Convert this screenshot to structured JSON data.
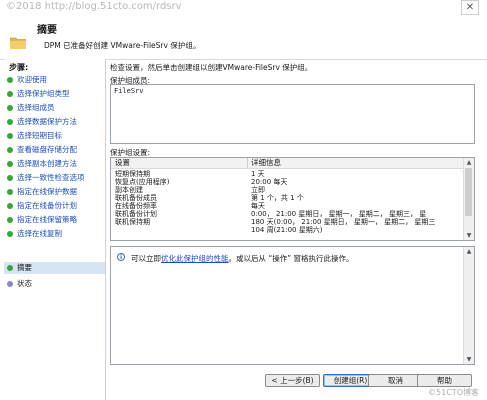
{
  "watermark_top": "©2018 http://blog.51cto.com/rdsrv",
  "header": {
    "title": "摘要",
    "description": "DPM 已准备好创建 VMware-FileSrv 保护组。"
  },
  "steps": {
    "title": "步骤:",
    "items": [
      {
        "label": "欢迎使用",
        "state": "done"
      },
      {
        "label": "选择保护组类型",
        "state": "done"
      },
      {
        "label": "选择组成员",
        "state": "done"
      },
      {
        "label": "选择数据保护方法",
        "state": "done"
      },
      {
        "label": "选择短期目标",
        "state": "done"
      },
      {
        "label": "查看磁盘存储分配",
        "state": "done"
      },
      {
        "label": "选择副本创建方法",
        "state": "done"
      },
      {
        "label": "选择一致性检查选项",
        "state": "done"
      },
      {
        "label": "指定在线保护数据",
        "state": "done"
      },
      {
        "label": "指定在线备份计划",
        "state": "done"
      },
      {
        "label": "指定在线保留策略",
        "state": "done"
      },
      {
        "label": "选择在线复制",
        "state": "done"
      },
      {
        "label": "摘要",
        "state": "current"
      },
      {
        "label": "状态",
        "state": "pending"
      }
    ]
  },
  "main": {
    "instruction": "检查设置，然后单击创建组以创建VMware-FileSrv 保护组。",
    "members_label": "保护组成员:",
    "members": [
      "FileSrv"
    ],
    "settings_label": "保护组设置:",
    "settings_headers": [
      "设置",
      "详细信息"
    ],
    "settings_rows": [
      [
        "短期保持期",
        "1 天"
      ],
      [
        "恢复点(应用程序)",
        "20:00 每天"
      ],
      [
        "副本创建",
        "立即"
      ],
      [
        "联机备份成员",
        "第 1 个，共 1 个"
      ],
      [
        "在线备份频率",
        "每天"
      ],
      [
        "联机备份计划",
        "0:00， 21:00 星期日， 星期一， 星期二， 星期三， 星"
      ],
      [
        "联机保持期",
        "180 天(0:00， 21:00 星期日， 星期一， 星期二， 星期三"
      ],
      [
        "",
        "104 周(21:00 星期六)"
      ]
    ],
    "info_prefix": "可以立即",
    "info_link": "优化此保护组的性能",
    "info_suffix": "。或以后从 “操作” 窗格执行此操作。"
  },
  "buttons": {
    "back": "< 上一步(B)",
    "create": "创建组(R)",
    "cancel": "取消",
    "help": "帮助"
  },
  "watermark_bottom": "©51CTO博客",
  "colors": {
    "link": "#1c4fb0",
    "done_dot": "#3aa33a",
    "pending_dot": "#8a86c4",
    "current_bg": "#d7e4f3"
  }
}
